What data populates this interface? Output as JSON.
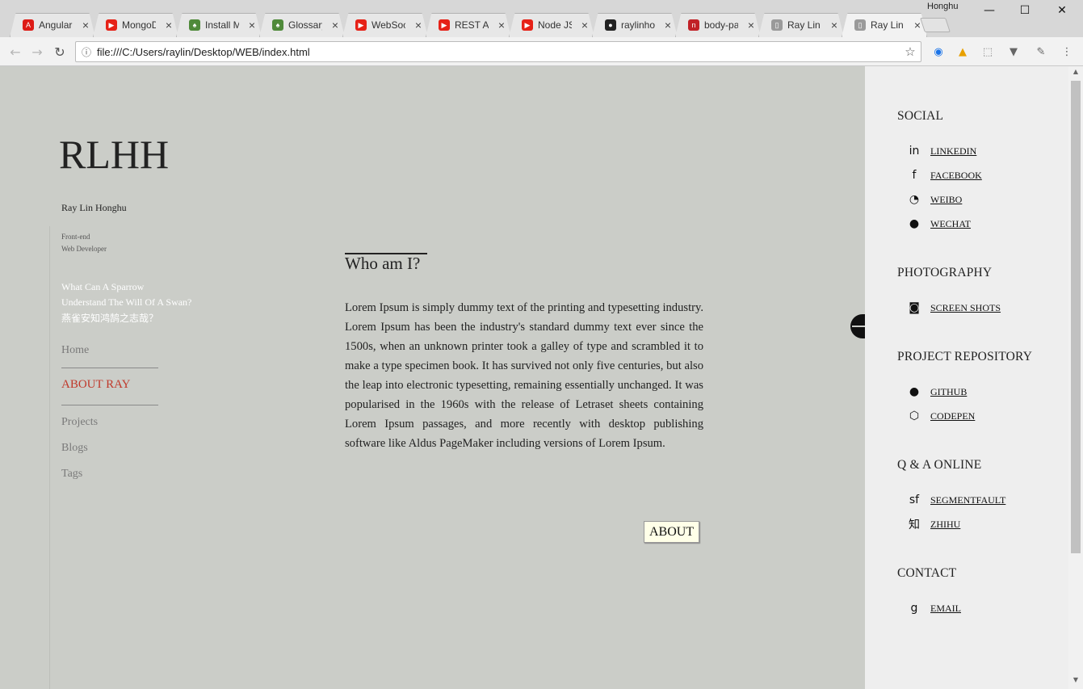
{
  "browser": {
    "tabs": [
      {
        "title": "Angular",
        "icon": "angular-icon",
        "color": "#dd1b16",
        "glyph": "A"
      },
      {
        "title": "MongoDB",
        "icon": "youtube-icon",
        "color": "#e62117",
        "glyph": "▶"
      },
      {
        "title": "Install MongoDB",
        "icon": "mongodb-leaf-icon",
        "color": "#4f8a3a",
        "glyph": "♠"
      },
      {
        "title": "Glossary",
        "icon": "mongodb-leaf-icon",
        "color": "#4f8a3a",
        "glyph": "♠"
      },
      {
        "title": "WebSocket",
        "icon": "youtube-icon",
        "color": "#e62117",
        "glyph": "▶"
      },
      {
        "title": "REST API",
        "icon": "youtube-icon",
        "color": "#e62117",
        "glyph": "▶"
      },
      {
        "title": "Node JS",
        "icon": "youtube-icon",
        "color": "#e62117",
        "glyph": "▶"
      },
      {
        "title": "raylinhonghu",
        "icon": "github-icon",
        "color": "#222222",
        "glyph": "●"
      },
      {
        "title": "body-parser",
        "icon": "npm-icon",
        "color": "#c12127",
        "glyph": "n"
      },
      {
        "title": "Ray Lin",
        "icon": "page-icon",
        "color": "#9a9a9a",
        "glyph": "▯"
      },
      {
        "title": "Ray Lin",
        "icon": "page-icon",
        "color": "#9a9a9a",
        "glyph": "▯"
      }
    ],
    "profile_name": "Honghu",
    "url": "file:///C:/Users/raylin/Desktop/WEB/index.html",
    "window_controls": {
      "minimize": "—",
      "maximize": "☐",
      "close": "✕"
    }
  },
  "page": {
    "site_title": "RLHH",
    "author": "Ray Lin Honghu",
    "role_line1": "Front-end",
    "role_line2": "Web Developer",
    "quote_line1": "What Can A Sparrow",
    "quote_line2": "Understand The Will Of A Swan?",
    "quote_line3": "燕雀安知鸿鹄之志哉？",
    "nav": {
      "home": "Home",
      "about": "ABOUT RAY",
      "projects": "Projects",
      "blogs": "Blogs",
      "tags": "Tags"
    },
    "heading": "Who am I?",
    "paragraph": "Lorem Ipsum is simply dummy text of the printing and typesetting industry. Lorem Ipsum has been the industry's standard dummy text ever since the 1500s, when an unknown printer took a galley of type and scrambled it to make a type specimen book. It has survived not only five centuries, but also the leap into electronic typesetting, remaining essentially unchanged. It was popularised in the 1960s with the release of Letraset sheets containing Lorem Ipsum passages, and more recently with desktop publishing software like Aldus PageMaker including versions of Lorem Ipsum.",
    "about_button": "ABOUT",
    "active_nav_color": "#c0392b"
  },
  "sidebar": {
    "social": {
      "title": "SOCIAL",
      "links": [
        {
          "label": "LINKEDIN",
          "icon": "linkedin-icon",
          "glyph": "in"
        },
        {
          "label": "FACEBOOK",
          "icon": "facebook-icon",
          "glyph": "f"
        },
        {
          "label": "WEIBO",
          "icon": "weibo-icon",
          "glyph": "◔"
        },
        {
          "label": "WECHAT",
          "icon": "wechat-icon",
          "glyph": "●"
        }
      ]
    },
    "photography": {
      "title": "PHOTOGRAPHY",
      "links": [
        {
          "label": "SCREEN SHOTS",
          "icon": "camera-icon",
          "glyph": "◙"
        }
      ]
    },
    "repository": {
      "title": "PROJECT REPOSITORY",
      "links": [
        {
          "label": "GITHUB",
          "icon": "github-icon",
          "glyph": "●"
        },
        {
          "label": "CODEPEN",
          "icon": "codepen-icon",
          "glyph": "⬡"
        }
      ]
    },
    "qa": {
      "title": "Q & A ONLINE",
      "links": [
        {
          "label": "SEGMENTFAULT",
          "icon": "segmentfault-icon",
          "glyph": "sf"
        },
        {
          "label": "ZHIHU",
          "icon": "zhihu-icon",
          "glyph": "知"
        }
      ]
    },
    "contact": {
      "title": "CONTACT",
      "links": [
        {
          "label": "EMAIL",
          "icon": "google-plus-icon",
          "glyph": "g"
        }
      ]
    }
  }
}
